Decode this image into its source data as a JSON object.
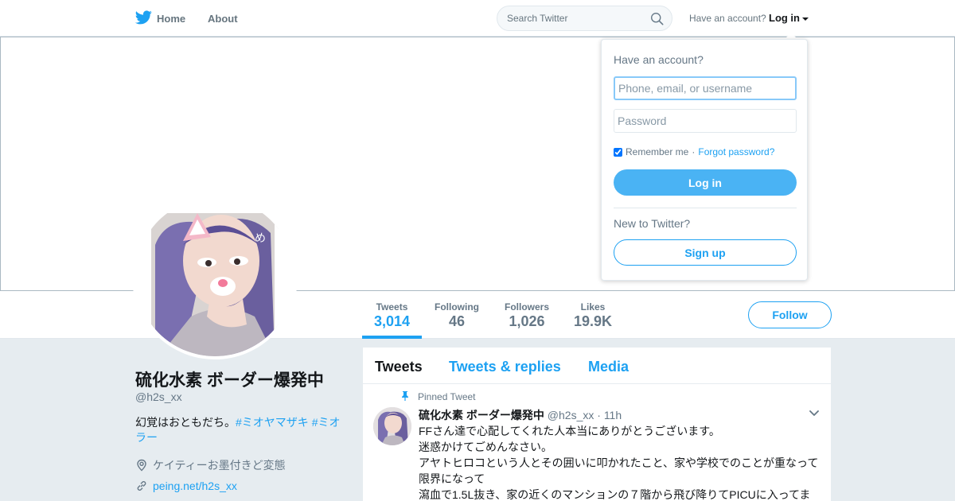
{
  "nav": {
    "home": "Home",
    "about": "About",
    "search_placeholder": "Search Twitter",
    "have_account": "Have an account?",
    "login": "Log in"
  },
  "colors": {
    "accent": "#1da1f2",
    "button_blue": "#4ab3f4",
    "muted": "#657786",
    "background": "#e6ecf0"
  },
  "stats": [
    {
      "label": "Tweets",
      "value": "3,014",
      "active": true
    },
    {
      "label": "Following",
      "value": "46"
    },
    {
      "label": "Followers",
      "value": "1,026"
    },
    {
      "label": "Likes",
      "value": "19.9K"
    }
  ],
  "follow_button": "Follow",
  "profile": {
    "name": "硫化水素 ボーダー爆発中",
    "handle": "@h2s_xx",
    "bio_text": "幻覚はおともだち。",
    "bio_tag1": "#ミオヤマザキ",
    "bio_tag2": "#ミオラー",
    "location": "ケイティーお墨付きど変態",
    "url": "peing.net/h2s_xx",
    "avatar_sticker": "め"
  },
  "timeline": {
    "tabs": [
      "Tweets",
      "Tweets & replies",
      "Media"
    ],
    "pinned_label": "Pinned Tweet",
    "tweet": {
      "name": "硫化水素 ボーダー爆発中",
      "handle": "@h2s_xx",
      "time": "11h",
      "lines": [
        "FFさん達で心配してくれた人本当にありがとうございます。",
        "迷惑かけてごめんなさい。",
        "アヤトヒロコという人とその囲いに叩かれたこと、家や学校でのことが重なって限界になって",
        "瀉血で1.5L抜き、家の近くのマンションの７階から飛び降りてPICUに入ってま"
      ]
    }
  },
  "login_dropdown": {
    "title": "Have an account?",
    "username_placeholder": "Phone, email, or username",
    "password_placeholder": "Password",
    "remember": "Remember me",
    "separator": "·",
    "forgot": "Forgot password?",
    "login_button": "Log in",
    "new_to": "New to Twitter?",
    "signup_button": "Sign up"
  },
  "icons": {
    "logo": "twitter-bird-icon",
    "search": "search-icon",
    "caret": "caret-down-icon",
    "location": "location-pin-icon",
    "link": "link-icon",
    "pin": "pin-icon",
    "tweet_menu": "chevron-down-icon"
  }
}
